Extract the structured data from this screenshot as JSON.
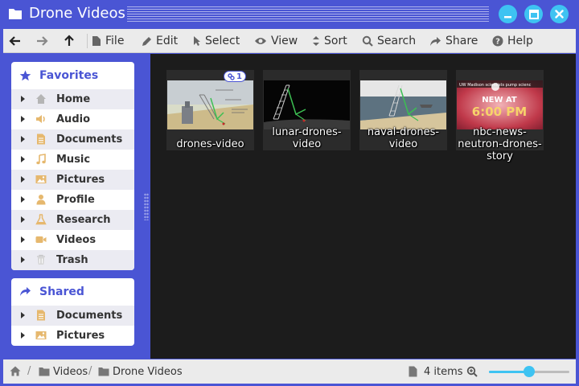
{
  "window": {
    "title": "Drone Videos",
    "title_icon": "folder-icon",
    "buttons": [
      "minimize-icon",
      "maximize-icon",
      "close-icon"
    ]
  },
  "menubar": {
    "nav": [
      "back-arrow-icon",
      "forward-arrow-icon",
      "up-arrow-icon"
    ],
    "items": [
      {
        "label": "File",
        "icon": "file-icon"
      },
      {
        "label": "Edit",
        "icon": "pencil-icon"
      },
      {
        "label": "Select",
        "icon": "cursor-icon"
      },
      {
        "label": "View",
        "icon": "eye-icon"
      },
      {
        "label": "Sort",
        "icon": "sort-icon"
      },
      {
        "label": "Search",
        "icon": "search-icon"
      },
      {
        "label": "Share",
        "icon": "share-icon"
      },
      {
        "label": "Help",
        "icon": "help-icon"
      }
    ]
  },
  "sidebar": {
    "favorites": {
      "title": "Favorites",
      "icon": "star-icon",
      "items": [
        {
          "label": "Home",
          "icon": "home-icon"
        },
        {
          "label": "Audio",
          "icon": "speaker-icon"
        },
        {
          "label": "Documents",
          "icon": "document-icon"
        },
        {
          "label": "Music",
          "icon": "music-note-icon"
        },
        {
          "label": "Pictures",
          "icon": "picture-icon"
        },
        {
          "label": "Profile",
          "icon": "user-icon"
        },
        {
          "label": "Research",
          "icon": "flask-icon"
        },
        {
          "label": "Videos",
          "icon": "video-camera-icon"
        },
        {
          "label": "Trash",
          "icon": "trash-icon"
        }
      ]
    },
    "shared": {
      "title": "Shared",
      "icon": "share-icon",
      "items": [
        {
          "label": "Documents",
          "icon": "document-icon"
        },
        {
          "label": "Pictures",
          "icon": "picture-icon"
        }
      ]
    }
  },
  "files": [
    {
      "name": "drones-video",
      "badge": "1",
      "badge_icon": "link-icon"
    },
    {
      "name": "lunar-drones-video"
    },
    {
      "name": "naval-drones-video"
    },
    {
      "name": "nbc-news-neutron-drones-story",
      "thumb_caption": "NEW AT",
      "thumb_time": "6:00 PM",
      "thumb_ticker": "UW Madison scientists pump scienc"
    }
  ],
  "statusbar": {
    "breadcrumb": [
      "Videos",
      "Drone Videos"
    ],
    "item_count": "4 items",
    "zoom_level": 0.5
  },
  "colors": {
    "accent": "#4a55d4",
    "window_button": "#3ec3f2",
    "content_bg": "#1c1c1c",
    "folder_icon": "#a9765a"
  }
}
